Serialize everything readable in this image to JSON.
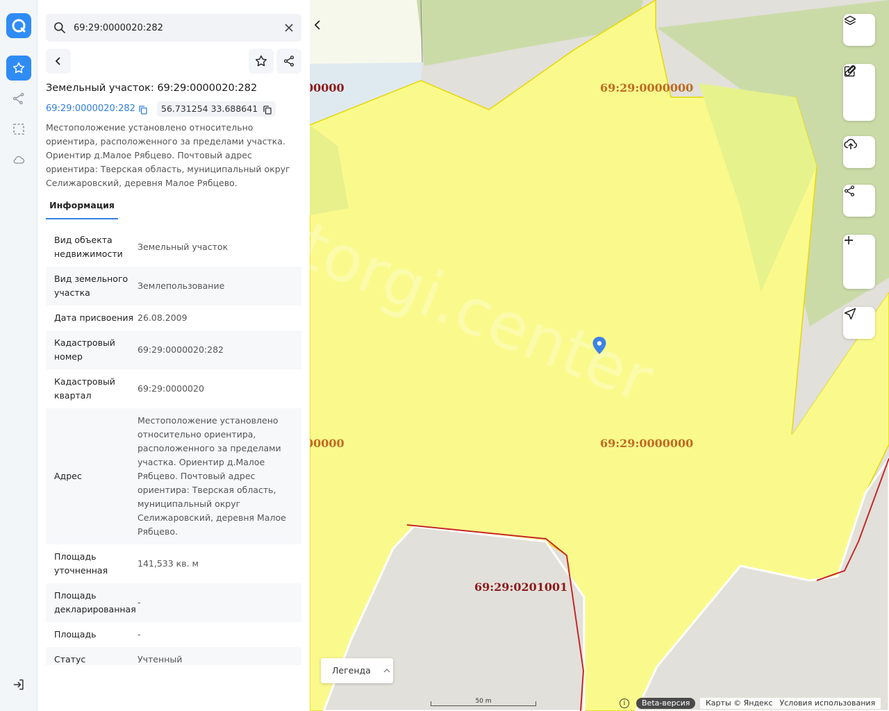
{
  "search": {
    "value": "69:29:0000020:282",
    "placeholder": ""
  },
  "panel": {
    "title": "Земельный участок: 69:29:0000020:282",
    "cadastral_link": "69:29:0000020:282",
    "coordinates": "56.731254 33.688641",
    "description": "Местоположение установлено относительно ориентира, расположенного за пределами участка. Ориентир д.Малое Рябцево. Почтовый адрес ориентира: Тверская область, муниципальный округ Селижаровский, деревня Малое Рябцево.",
    "tabs": [
      {
        "label": "Информация"
      }
    ],
    "rows": [
      {
        "key": "Вид объекта недвижимости",
        "value": "Земельный участок"
      },
      {
        "key": "Вид земельного участка",
        "value": "Землепользование"
      },
      {
        "key": "Дата присвоения",
        "value": "26.08.2009"
      },
      {
        "key": "Кадастровый номер",
        "value": "69:29:0000020:282"
      },
      {
        "key": "Кадастровый квартал",
        "value": "69:29:0000020"
      },
      {
        "key": "Адрес",
        "value": "Местоположение установлено относительно ориентира, расположенного за пределами участка. Ориентир д.Малое Рябцево. Почтовый адрес ориентира: Тверская область, муниципальный округ Селижаровский, деревня Малое Рябцево."
      },
      {
        "key": "Площадь уточненная",
        "value": "141,533 кв. м"
      },
      {
        "key": "Площадь декларированная",
        "value": "-"
      },
      {
        "key": "Площадь",
        "value": "-"
      },
      {
        "key": "Статус",
        "value": "Учтенный"
      }
    ]
  },
  "map": {
    "labels": [
      "00000",
      "69:29:0000000",
      "00000",
      "69:29:0000000",
      "69:29:0201001"
    ],
    "watermark": "torgi.center",
    "legend_label": "Легенда",
    "scale_label": "50 m",
    "info_glyph": "i",
    "beta_label": "Beta-версия",
    "copyright": "Карты © Яндекс",
    "terms": "Условия использования",
    "colors": {
      "parcel_yellow": "#fafa8c",
      "forest_green": "#cbdba8",
      "road_gray": "#e2e0da",
      "boundary_red": "#c62828",
      "accent_blue": "#2f8cf5"
    }
  },
  "icons": {
    "rail": [
      "logo-icon",
      "star-icon",
      "route-icon",
      "select-area-icon",
      "cloud-icon",
      "logout-icon"
    ],
    "map_controls": [
      "layers-icon",
      "ruler-icon",
      "edit-icon",
      "upload-icon",
      "share-icon",
      "zoom-in-icon",
      "zoom-out-icon",
      "locate-icon"
    ]
  }
}
